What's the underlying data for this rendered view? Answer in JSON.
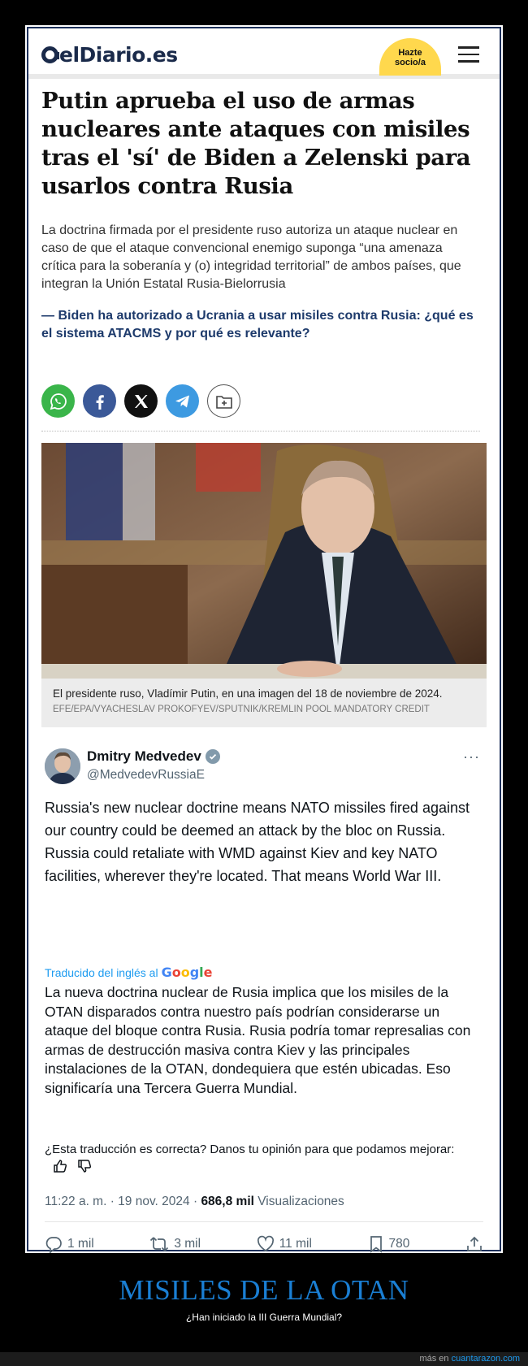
{
  "header": {
    "logo_text": "elDiario.es",
    "cta_label": "Hazte\nsocio/a"
  },
  "article": {
    "title": "Putin aprueba el uso de armas nucleares ante ataques con misiles tras el 'sí' de Biden a Zelenski para usarlos contra Rusia",
    "lede": "La doctrina firmada por el presidente ruso autoriza un ataque nuclear en caso de que el ataque convencional enemigo suponga “una amenaza crítica para la soberanía y (o) integridad territorial” de ambos países, que integran la Unión Estatal Rusia-Bielorrusia",
    "related": "— Biden ha autorizado a Ucrania a usar misiles contra Rusia: ¿qué es el sistema ATACMS y por qué es relevante?",
    "share_icons": [
      "whatsapp-icon",
      "facebook-icon",
      "x-icon",
      "telegram-icon",
      "save-icon"
    ],
    "caption": "El presidente ruso, Vladímir Putin, en una imagen del 18 de noviembre de 2024.",
    "credit": "EFE/EPA/VYACHESLAV PROKOFYEV/SPUTNIK/KREMLIN POOL MANDATORY CREDIT"
  },
  "tweet": {
    "name": "Dmitry Medvedev",
    "handle": "@MedvedevRussiaE",
    "more": "···",
    "text": "Russia's new nuclear doctrine means NATO missiles fired against our country could be deemed an attack by the bloc on Russia. Russia could retaliate with WMD against Kiev and key NATO facilities, wherever they're located. That means World War III.",
    "translated_label": "Traducido del inglés al",
    "translator": "Google",
    "translation": "La nueva doctrina nuclear de Rusia implica que los misiles de la OTAN disparados contra nuestro país podrían considerarse un ataque del bloque contra Rusia. Rusia podría tomar represalias con armas de destrucción masiva contra Kiev y las principales instalaciones de la OTAN, dondequiera que estén ubicadas. Eso significaría una Tercera Guerra Mundial.",
    "feedback_question": "¿Esta traducción es correcta? Danos tu opinión para que podamos mejorar:",
    "time": "11:22 a. m. · 19 nov. 2024 · ",
    "views_count": "686,8 mil",
    "views_label": " Visualizaciones",
    "replies": "1 mil",
    "retweets": "3 mil",
    "likes": "11 mil",
    "bookmarks": "780"
  },
  "footer": {
    "title": "MISILES DE LA OTAN",
    "subtitle": "¿Han iniciado la III Guerra Mundial?",
    "more_prefix": "más en ",
    "more_link": "cuantarazon.com"
  },
  "colors": {
    "brand_navy": "#1a2a4a",
    "cta_yellow": "#ffd84d",
    "related_link": "#1d3a6b",
    "footer_title": "#1a7fd4",
    "twitter_blue": "#1d9bf0"
  }
}
